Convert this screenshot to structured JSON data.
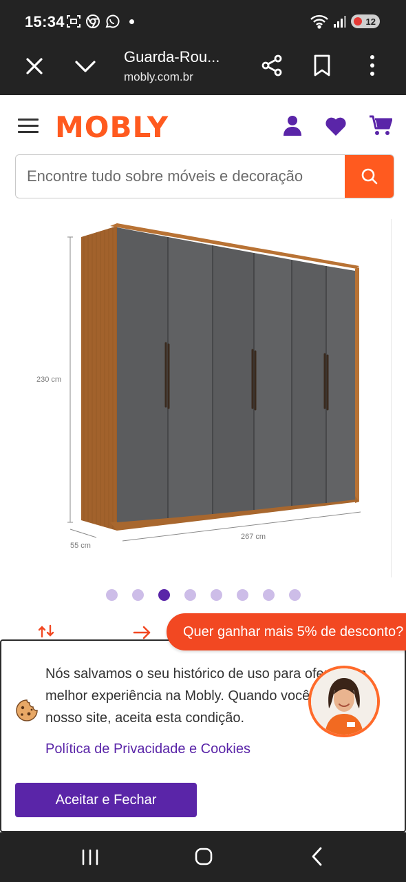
{
  "status_bar": {
    "time": "15:34",
    "battery_level": "12",
    "notification_icons": [
      "screenshot-icon",
      "chrome-icon",
      "whatsapp-icon"
    ]
  },
  "browser": {
    "page_title": "Guarda-Rou...",
    "url": "mobly.com.br"
  },
  "site": {
    "logo": "MOBLY",
    "brand_color": "#ff5a1f",
    "accent_color": "#5a25a8"
  },
  "search": {
    "placeholder": "Encontre tudo sobre móveis e decoração"
  },
  "product_image": {
    "height_label": "230 cm",
    "width_label": "267 cm",
    "depth_label": "55 cm"
  },
  "carousel": {
    "total_slides": 8,
    "active_index": 2
  },
  "promo": {
    "text": "Quer ganhar mais 5% de desconto?"
  },
  "cookie_banner": {
    "message": "Nós salvamos o seu histórico de uso para oferecer a melhor experiência na Mobly. Quando você navega no nosso site, aceita esta condição.",
    "policy_link": "Política de Privacidade e Cookies",
    "accept_button": "Aceitar e Fechar"
  }
}
